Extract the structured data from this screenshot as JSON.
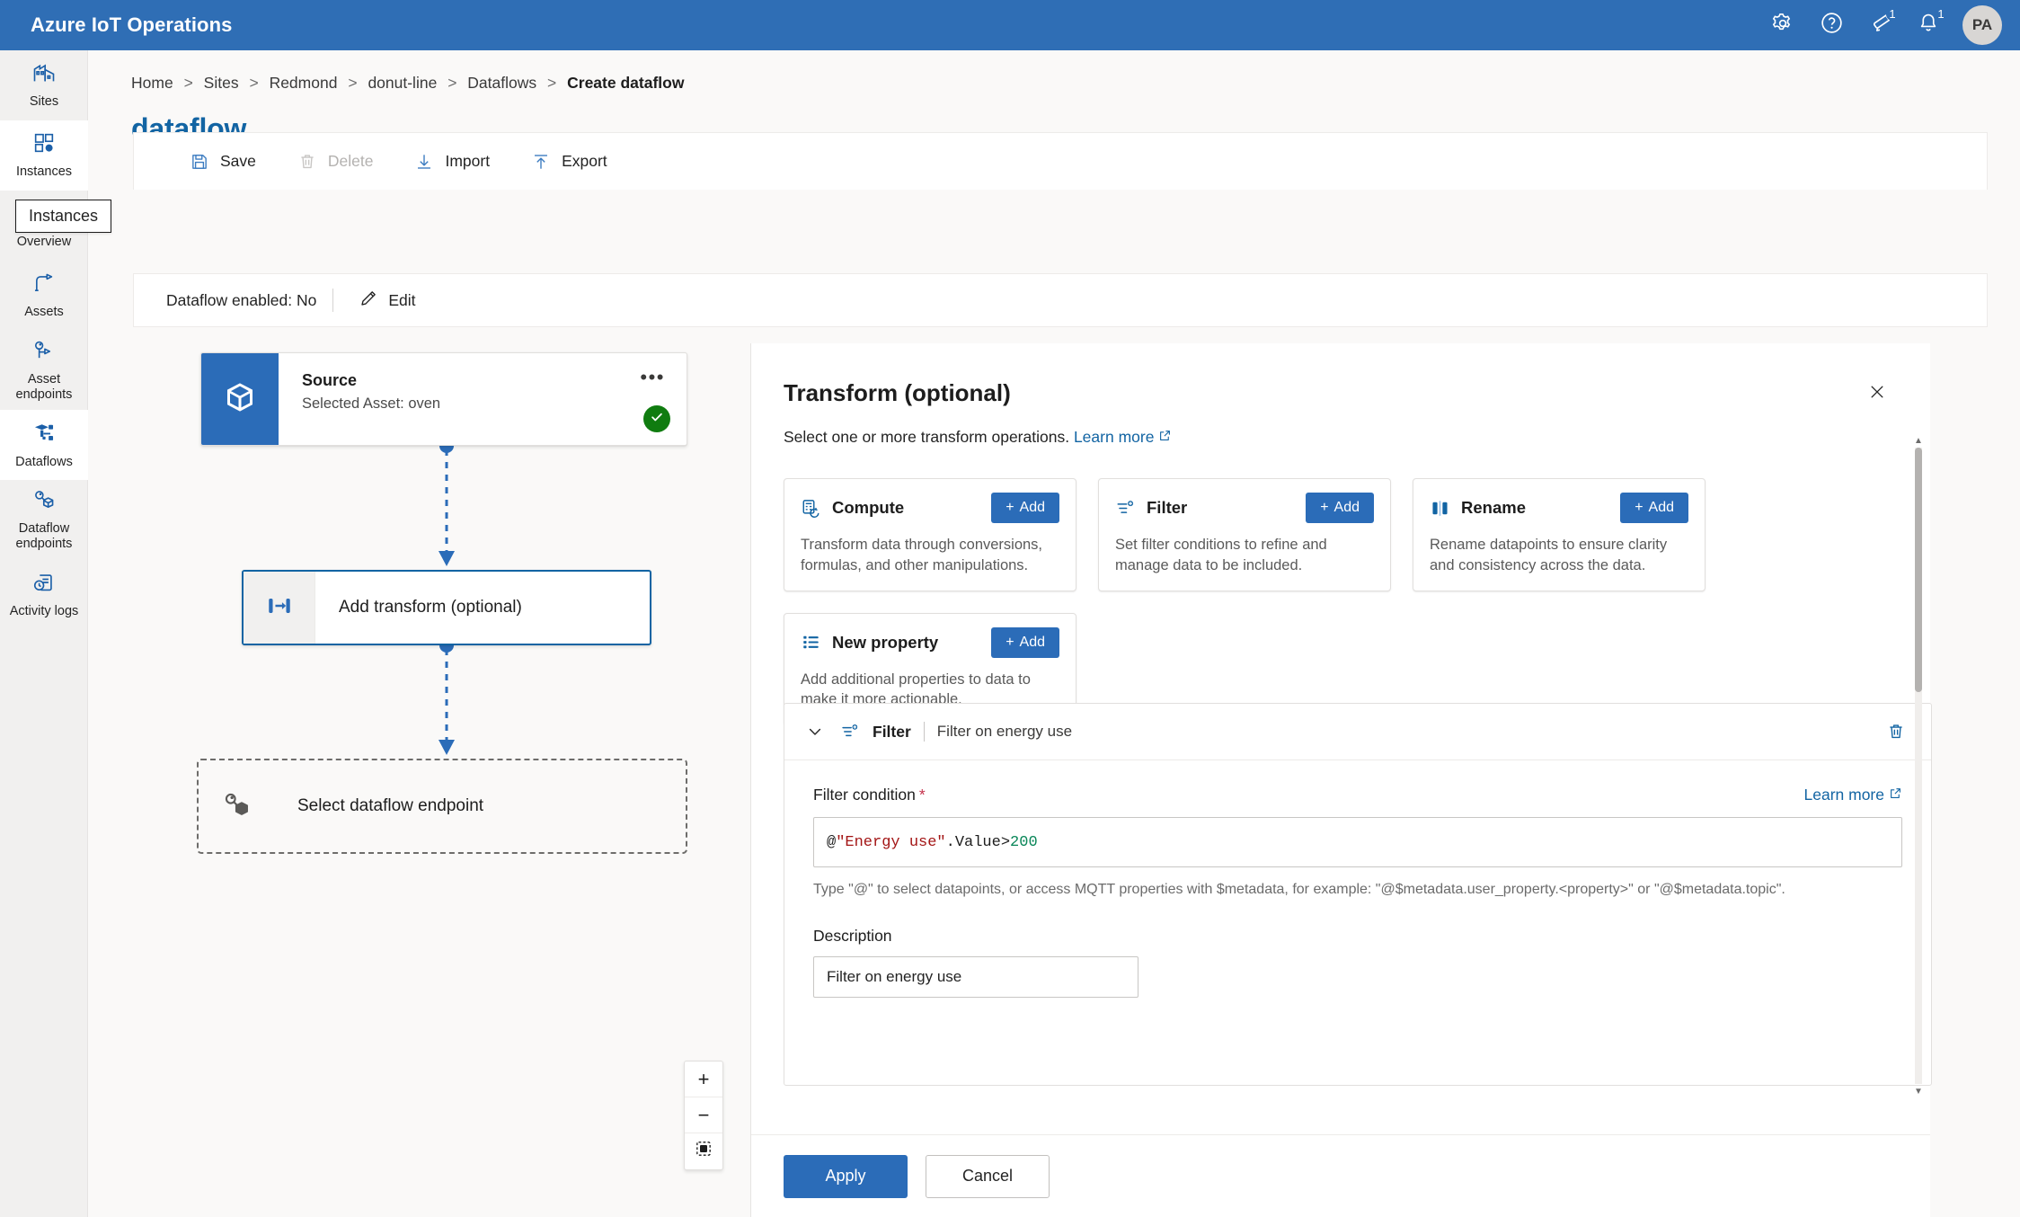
{
  "header": {
    "app_title": "Azure IoT Operations",
    "icons": [
      {
        "name": "gear-icon",
        "label": "Settings",
        "badge": null
      },
      {
        "name": "help-icon",
        "label": "Help",
        "badge": null
      },
      {
        "name": "megaphone-icon",
        "label": "Announcements",
        "badge": "1"
      },
      {
        "name": "bell-icon",
        "label": "Notifications",
        "badge": "1"
      }
    ],
    "avatar_initials": "PA"
  },
  "sidebar": {
    "tooltip": "Instances",
    "items": [
      {
        "label": "Sites",
        "icon": "sites-icon",
        "active": false
      },
      {
        "label": "Instances",
        "icon": "instances-icon",
        "active": true
      },
      {
        "label": "Overview",
        "icon": "overview-icon",
        "active": false
      },
      {
        "label": "Assets",
        "icon": "assets-icon",
        "active": false
      },
      {
        "label": "Asset endpoints",
        "icon": "asset-endpoints-icon",
        "active": false
      },
      {
        "label": "Dataflows",
        "icon": "dataflows-icon",
        "active": true
      },
      {
        "label": "Dataflow endpoints",
        "icon": "dataflow-endpoints-icon",
        "active": false
      },
      {
        "label": "Activity logs",
        "icon": "activity-logs-icon",
        "active": false
      }
    ]
  },
  "breadcrumb": {
    "items": [
      "Home",
      "Sites",
      "Redmond",
      "donut-line",
      "Dataflows"
    ],
    "current": "Create dataflow",
    "separator": ">"
  },
  "page": {
    "title": "dataflow"
  },
  "command_bar": {
    "save": "Save",
    "delete": "Delete",
    "import": "Import",
    "export": "Export"
  },
  "enabled_strip": {
    "status_text": "Dataflow enabled: No",
    "edit_label": "Edit"
  },
  "canvas": {
    "source_node": {
      "title": "Source",
      "subtitle": "Selected Asset: oven",
      "more_glyph": "•••",
      "status": "complete"
    },
    "transform_node": {
      "label": "Add transform (optional)"
    },
    "destination_node": {
      "label": "Select dataflow endpoint"
    },
    "zoom_controls": {
      "zoom_in": "+",
      "zoom_out": "−",
      "fit_view": "fit-to-view"
    }
  },
  "panel": {
    "title": "Transform (optional)",
    "subtitle": "Select one or more transform operations.",
    "learn_more": "Learn more",
    "close_glyph": "✕",
    "operations": [
      {
        "name": "Compute",
        "icon": "compute-icon",
        "add_label": "Add",
        "description": "Transform data through conversions, formulas, and other manipulations."
      },
      {
        "name": "Filter",
        "icon": "filter-icon",
        "add_label": "Add",
        "description": "Set filter conditions to refine and manage data to be included."
      },
      {
        "name": "Rename",
        "icon": "rename-icon",
        "add_label": "Add",
        "description": "Rename datapoints to ensure clarity and consistency across the data."
      },
      {
        "name": "New property",
        "icon": "new-property-icon",
        "add_label": "Add",
        "description": "Add additional properties to data to make it more actionable."
      }
    ],
    "detail": {
      "type_label": "Filter",
      "summary": "Filter on energy use",
      "condition_label": "Filter condition",
      "required_mark": "*",
      "condition_learn_more": "Learn more",
      "code": {
        "at": "@",
        "string": "\"Energy use\"",
        "property": ".Value",
        "operator": " > ",
        "number": "200"
      },
      "hint": "Type \"@\" to select datapoints, or access MQTT properties with $metadata, for example: \"@$metadata.user_property.<property>\" or \"@$metadata.topic\".",
      "description_label": "Description",
      "description_value": "Filter on energy use"
    },
    "footer": {
      "apply": "Apply",
      "cancel": "Cancel"
    }
  },
  "colors": {
    "brand_blue": "#2f6eb5",
    "accent_blue": "#1264a3",
    "button_blue": "#2b6cb8",
    "success_green": "#107c10",
    "required_red": "#c4314b",
    "code_string": "#a31515",
    "code_number": "#098658"
  }
}
